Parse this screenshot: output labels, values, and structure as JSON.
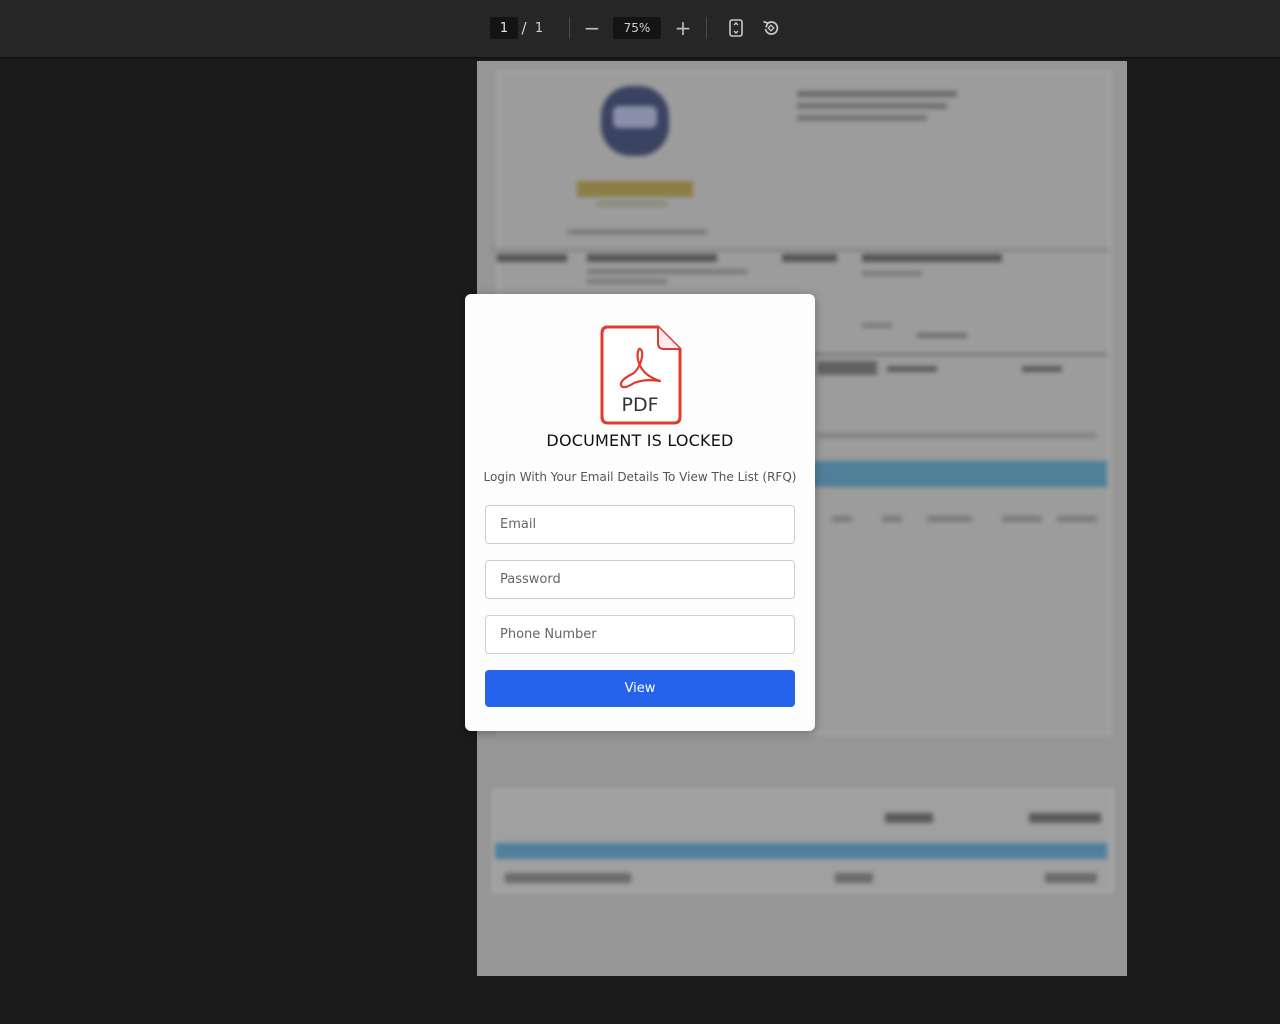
{
  "toolbar": {
    "current_page": "1",
    "page_separator": "/",
    "total_pages": "1",
    "zoom_out_symbol": "−",
    "zoom_level": "75%",
    "zoom_in_symbol": "+",
    "fit_page_icon": "fit-page-icon",
    "rotate_icon": "rotate-icon"
  },
  "colors": {
    "viewer_background": "#1b1b1b",
    "toolbar_background": "#262626",
    "primary_button": "#2563eb",
    "pdf_icon_red": "#e23a2f"
  },
  "modal": {
    "icon_label": "PDF",
    "title": "DOCUMENT IS LOCKED",
    "subtitle": "Login With Your Email Details To View The List (RFQ)",
    "email_placeholder": "Email",
    "password_placeholder": "Password",
    "phone_placeholder": "Phone Number",
    "button_label": "View"
  }
}
